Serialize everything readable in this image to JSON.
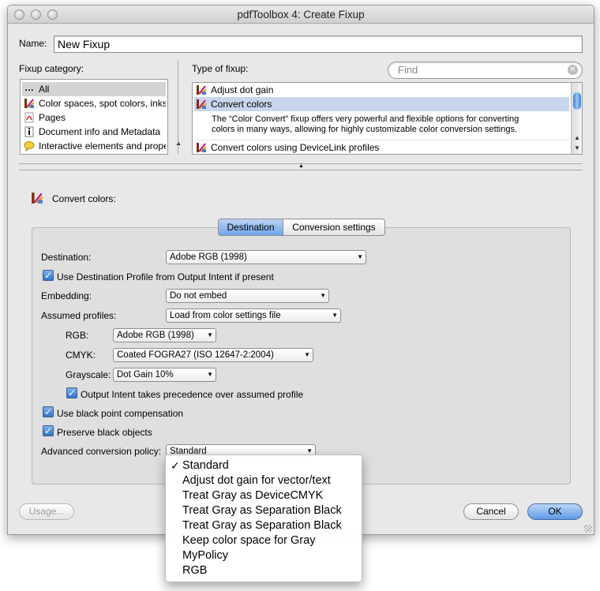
{
  "window": {
    "title": "pdfToolbox 4: Create Fixup"
  },
  "name": {
    "label": "Name:",
    "value": "New Fixup"
  },
  "fixup_category": {
    "label": "Fixup category:",
    "items": [
      {
        "label": "All",
        "icon": "ellipsis-icon"
      },
      {
        "label": "Color spaces, spot colors, inks",
        "icon": "color-fixup-icon"
      },
      {
        "label": "Pages",
        "icon": "pdf-page-icon"
      },
      {
        "label": "Document info and Metadata",
        "icon": "document-info-icon"
      },
      {
        "label": "Interactive elements and prope",
        "icon": "comment-bubble-icon"
      }
    ]
  },
  "type_of_fixup": {
    "label": "Type of fixup:",
    "search_placeholder": "Find",
    "items": [
      {
        "label": "Adjust dot gain"
      },
      {
        "label": "Convert colors"
      },
      {
        "label": "Convert colors using DeviceLink profiles"
      }
    ],
    "description_line1": "The “Color Convert” fixup offers very powerful and flexible options for converting",
    "description_line2": "colors in many ways, allowing for highly customizable color conversion settings."
  },
  "detail": {
    "heading": "Convert colors:",
    "tabs": [
      {
        "label": "Destination"
      },
      {
        "label": "Conversion settings"
      }
    ],
    "destination_label": "Destination:",
    "destination_value": "Adobe RGB (1998)",
    "use_dest_profile_label": "Use Destination Profile from Output Intent if present",
    "embedding_label": "Embedding:",
    "embedding_value": "Do not embed",
    "assumed_label": "Assumed profiles:",
    "assumed_value": "Load from color settings file",
    "rgb_label": "RGB:",
    "rgb_value": "Adobe RGB (1998)",
    "cmyk_label": "CMYK:",
    "cmyk_value": "Coated FOGRA27 (ISO 12647-2:2004)",
    "gray_label": "Grayscale:",
    "gray_value": "Dot Gain 10%",
    "output_intent_label": "Output Intent takes precedence over assumed profile",
    "bpc_label": "Use black point compensation",
    "preserve_black_label": "Preserve black objects",
    "policy_label": "Advanced conversion policy:",
    "policy_value": "Standard"
  },
  "buttons": {
    "usage": "Usage...",
    "cancel": "Cancel",
    "ok": "OK"
  },
  "policy_menu": {
    "checkmark": "✓",
    "items": [
      "Standard",
      "Adjust dot gain for vector/text",
      "Treat Gray as DeviceCMYK",
      "Treat Gray as Separation Black",
      "Treat Gray as Separation Black",
      "Keep color space for Gray",
      "MyPolicy",
      "RGB"
    ]
  },
  "colors": {
    "accent_blue": "#3d7fd6",
    "selection_blue": "#c7d6ec",
    "window_bg": "#e8e8e8"
  }
}
